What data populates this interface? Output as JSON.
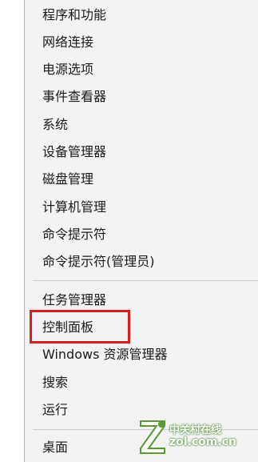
{
  "menu": {
    "items": [
      {
        "label": "程序和功能"
      },
      {
        "label": "网络连接"
      },
      {
        "label": "电源选项"
      },
      {
        "label": "事件查看器"
      },
      {
        "label": "系统"
      },
      {
        "label": "设备管理器"
      },
      {
        "label": "磁盘管理"
      },
      {
        "label": "计算机管理"
      },
      {
        "label": "命令提示符"
      },
      {
        "label": "命令提示符(管理员)"
      },
      {
        "label": "任务管理器"
      },
      {
        "label": "控制面板"
      },
      {
        "label": "Windows 资源管理器"
      },
      {
        "label": "搜索"
      },
      {
        "label": "运行"
      },
      {
        "label": "桌面"
      }
    ],
    "highlighted_item": "控制面板"
  },
  "watermark": {
    "chinese_text": "中关村在线",
    "domain_text": "zol.com.cn",
    "brand_color": "#5a9a32"
  },
  "colors": {
    "menu_background": "#f3f3f3",
    "highlight_border": "#d62020"
  }
}
